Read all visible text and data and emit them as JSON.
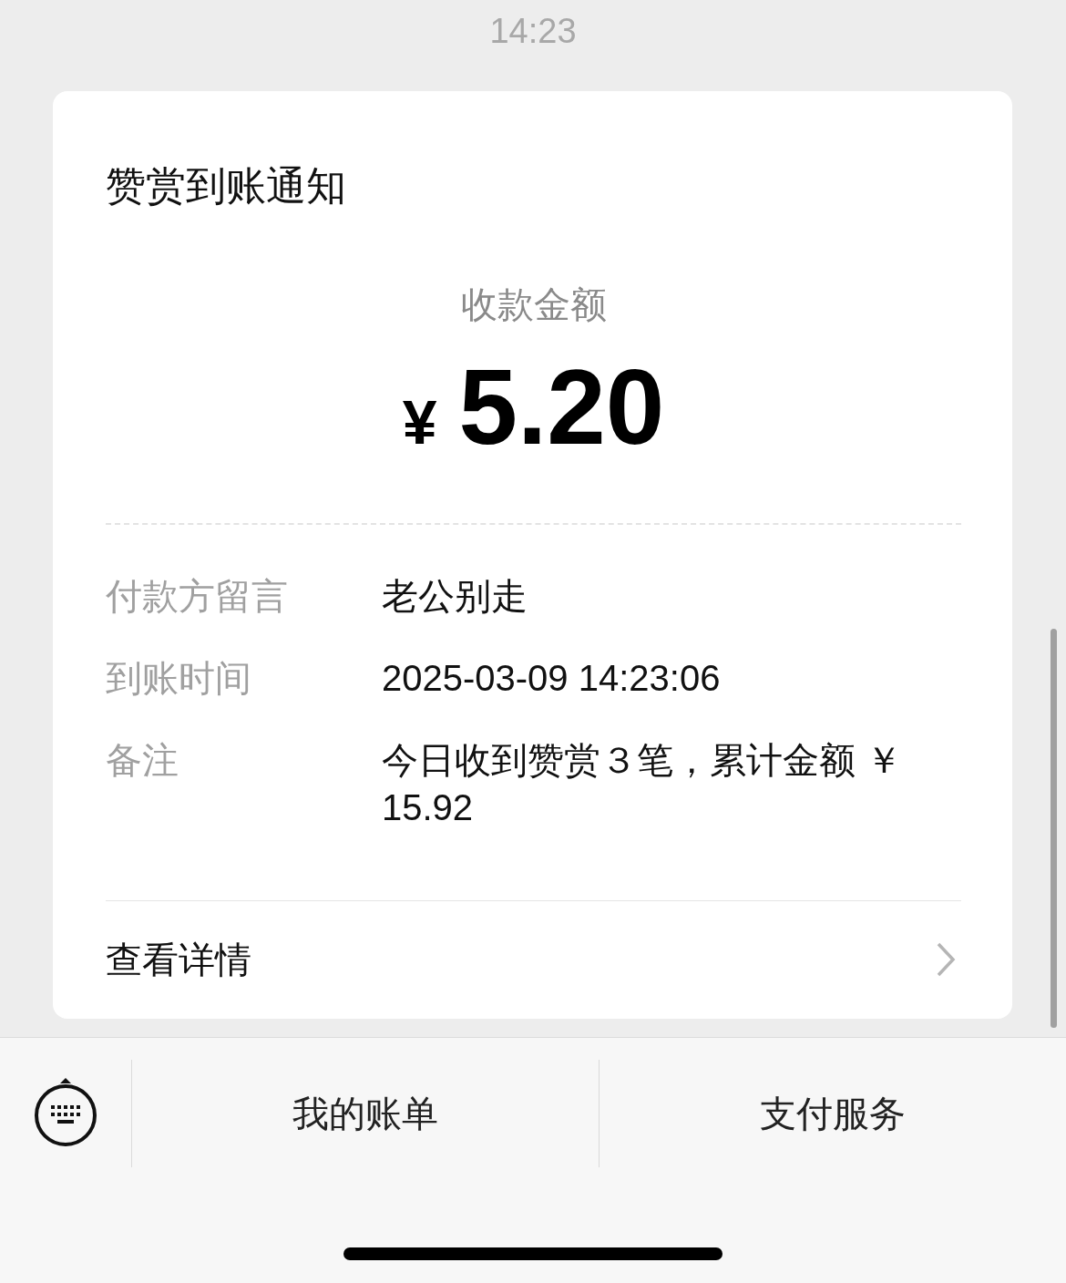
{
  "time": "14:23",
  "card": {
    "title": "赞赏到账通知",
    "amount_label": "收款金额",
    "currency": "¥",
    "amount": "5.20",
    "rows": [
      {
        "label": "付款方留言",
        "value": "老公别走"
      },
      {
        "label": "到账时间",
        "value": "2025-03-09 14:23:06"
      },
      {
        "label": "备注",
        "value": "今日收到赞赏３笔，累计金额 ￥ 15.92"
      }
    ],
    "link": "查看详情"
  },
  "menu": [
    "我的账单",
    "支付服务"
  ]
}
